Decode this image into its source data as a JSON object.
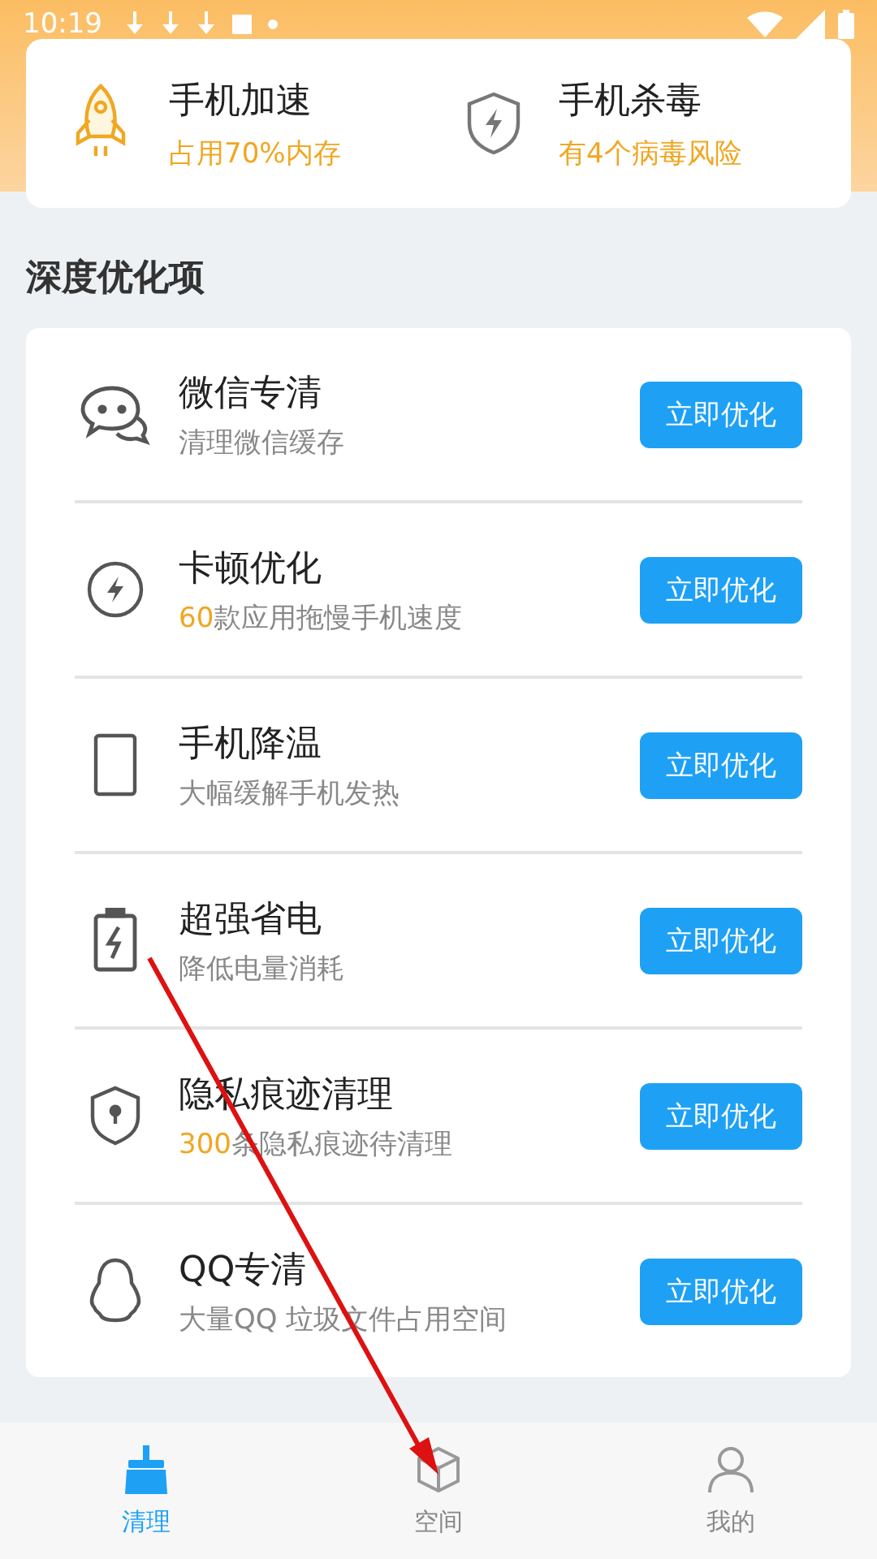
{
  "status_bar": {
    "time": "10:19"
  },
  "top_cards": [
    {
      "kind": "rocket",
      "title": "手机加速",
      "subtitle": "占用70%内存"
    },
    {
      "kind": "shield",
      "title": "手机杀毒",
      "subtitle": "有4个病毒风险"
    }
  ],
  "section_title": "深度优化项",
  "items": [
    {
      "kind": "chat",
      "title": "微信专清",
      "subtitle": "清理微信缓存",
      "button": "立即优化"
    },
    {
      "kind": "bolt",
      "title": "卡顿优化",
      "highlight_text": "60",
      "subtitle": "款应用拖慢手机速度",
      "button": "立即优化"
    },
    {
      "kind": "phone",
      "title": "手机降温",
      "subtitle": "大幅缓解手机发热",
      "button": "立即优化"
    },
    {
      "kind": "battery",
      "title": "超强省电",
      "subtitle": "降低电量消耗",
      "button": "立即优化"
    },
    {
      "kind": "lock",
      "title": "隐私痕迹清理",
      "highlight_text": "300",
      "subtitle": "条隐私痕迹待清理",
      "button": "立即优化"
    },
    {
      "kind": "penguin",
      "title": "QQ专清",
      "subtitle": "大量QQ 垃圾文件占用空间",
      "button": "立即优化"
    }
  ],
  "tabs": [
    {
      "kind": "broom",
      "label": "清理",
      "selected": true
    },
    {
      "kind": "box",
      "label": "空间",
      "selected": false
    },
    {
      "kind": "person",
      "label": "我的",
      "selected": false
    }
  ]
}
